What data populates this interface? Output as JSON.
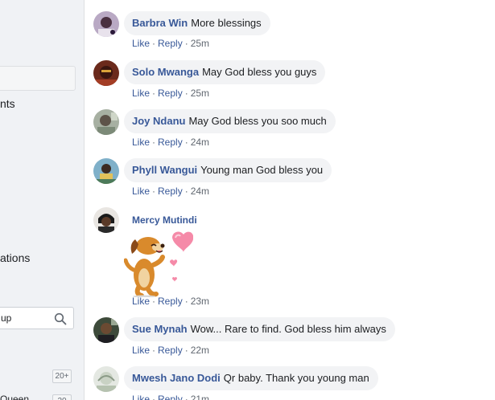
{
  "sidebar": {
    "item_1": "nts",
    "item_2": "ations",
    "search_placeholder": "up",
    "badge_1": "20+",
    "item_3": "Queen",
    "badge_2": "20"
  },
  "comments": [
    {
      "author": "Barbra Win",
      "text": "More blessings",
      "like": "Like",
      "reply": "Reply",
      "time": "25m"
    },
    {
      "author": "Solo Mwanga",
      "text": "May God bless you guys",
      "like": "Like",
      "reply": "Reply",
      "time": "25m"
    },
    {
      "author": "Joy Ndanu",
      "text": "May God bless you soo much",
      "like": "Like",
      "reply": "Reply",
      "time": "24m"
    },
    {
      "author": "Phyll Wangui",
      "text": "Young man God bless you",
      "like": "Like",
      "reply": "Reply",
      "time": "24m"
    },
    {
      "author": "Mercy Mutindi",
      "text": "",
      "like": "Like",
      "reply": "Reply",
      "time": "23m",
      "sticker": "dog-with-hearts"
    },
    {
      "author": "Sue Mynah",
      "text": "Wow... Rare to find. God bless him always",
      "like": "Like",
      "reply": "Reply",
      "time": "22m"
    },
    {
      "author": "Mwesh Jano Dodi",
      "text": "Qr baby. Thank you young man",
      "like": "Like",
      "reply": "Reply",
      "time": "21m"
    }
  ],
  "colors": {
    "link": "#385898",
    "bubble": "#f2f3f5",
    "meta": "#606770",
    "sidebar": "#f0f2f5"
  }
}
